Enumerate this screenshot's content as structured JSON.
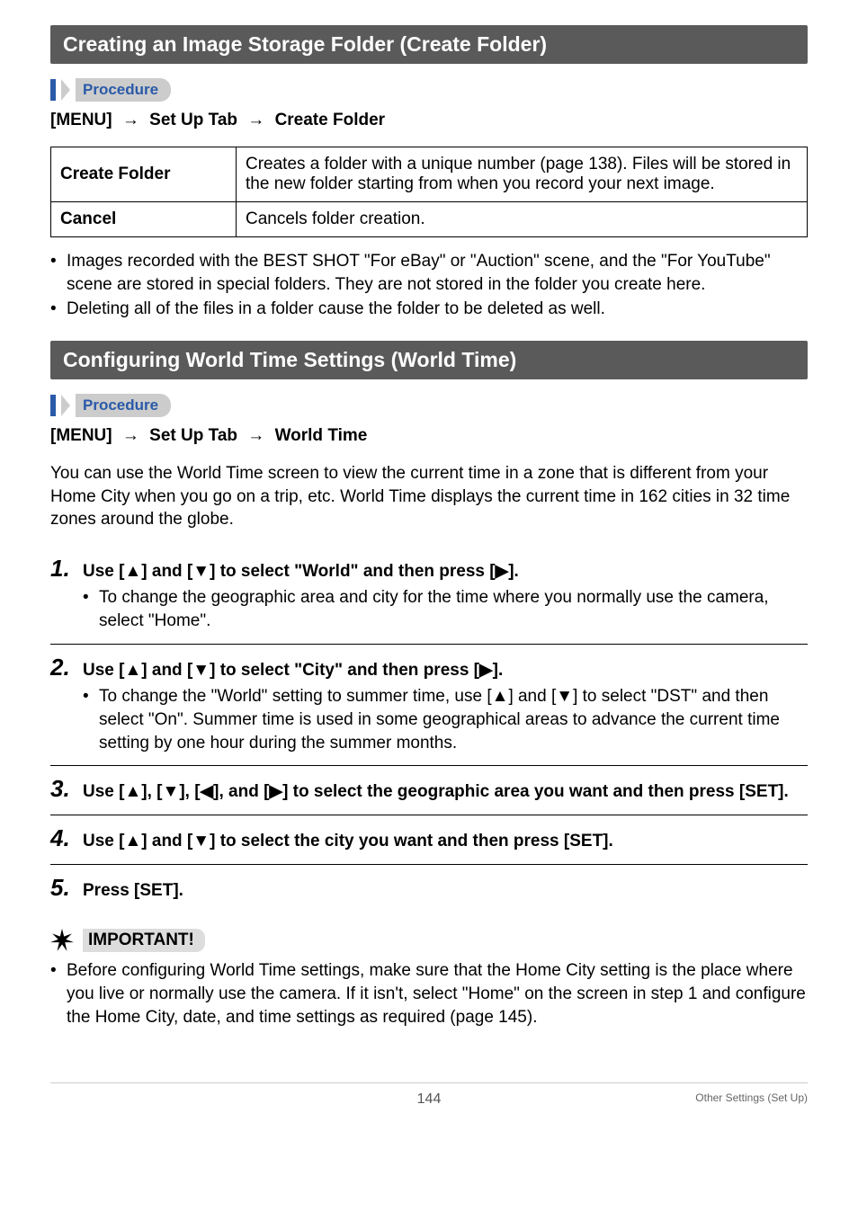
{
  "section1": {
    "title": "Creating an Image Storage Folder (Create Folder)",
    "procedure_label": "Procedure",
    "menu_path": {
      "p1": "[MENU]",
      "p2": "Set Up Tab",
      "p3": "Create Folder"
    },
    "table": {
      "r1": {
        "head": "Create Folder",
        "body": "Creates a folder with a unique number (page 138). Files will be stored in the new folder starting from when you record your next image."
      },
      "r2": {
        "head": "Cancel",
        "body": "Cancels folder creation."
      }
    },
    "bullets": [
      "Images recorded with the BEST SHOT \"For eBay\" or \"Auction\" scene, and the \"For YouTube\" scene are stored in special folders. They are not stored in the folder you create here.",
      "Deleting all of the files in a folder cause the folder to be deleted as well."
    ]
  },
  "section2": {
    "title": "Configuring World Time Settings (World Time)",
    "procedure_label": "Procedure",
    "menu_path": {
      "p1": "[MENU]",
      "p2": "Set Up Tab",
      "p3": "World Time"
    },
    "intro": "You can use the World Time screen to view the current time in a zone that is different from your Home City when you go on a trip, etc. World Time displays the current time in 162 cities in 32 time zones around the globe.",
    "steps": [
      {
        "num": "1.",
        "title_pre": "Use [",
        "g1": "▲",
        "title_mid1": "] and [",
        "g2": "▼",
        "title_mid2": "] to select \"World\" and then press [",
        "g3": "▶",
        "title_post": "].",
        "sub": "To change the geographic area and city for the time where you normally use the camera, select \"Home\"."
      },
      {
        "num": "2.",
        "title_pre": "Use [",
        "g1": "▲",
        "title_mid1": "] and [",
        "g2": "▼",
        "title_mid2": "] to select \"City\" and then press [",
        "g3": "▶",
        "title_post": "].",
        "sub_pre": "To change the \"World\" setting to summer time, use [",
        "sg1": "▲",
        "sub_mid1": "] and [",
        "sg2": "▼",
        "sub_mid2": "] to select \"DST\" and then select \"On\". Summer time is used in some geographical areas to advance the current time setting by one hour during the summer months."
      },
      {
        "num": "3.",
        "title_pre": "Use [",
        "g1": "▲",
        "title_mid1": "], [",
        "g2": "▼",
        "title_mid2": "], [",
        "g3": "◀",
        "title_mid3": "], and [",
        "g4": "▶",
        "title_post": "] to select the geographic area you want and then press [SET]."
      },
      {
        "num": "4.",
        "title_pre": "Use [",
        "g1": "▲",
        "title_mid1": "] and [",
        "g2": "▼",
        "title_post": "] to select the city you want and then press [SET]."
      },
      {
        "num": "5.",
        "title": "Press [SET]."
      }
    ],
    "important_label": "IMPORTANT!",
    "important_body": "Before configuring World Time settings, make sure that the Home City setting is the place where you live or normally use the camera. If it isn't, select \"Home\" on the screen in step 1 and configure the Home City, date, and time settings as required (page 145)."
  },
  "footer": {
    "page": "144",
    "section": "Other Settings (Set Up)"
  },
  "glyphs": {
    "arrow_right": "→"
  }
}
